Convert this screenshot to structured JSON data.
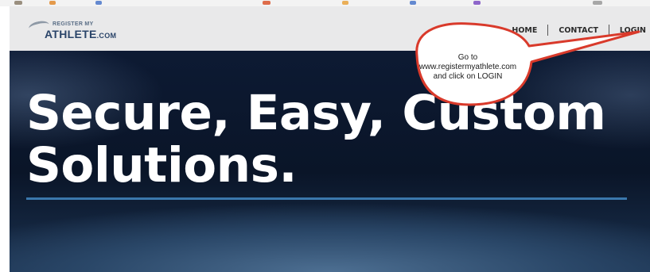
{
  "header": {
    "logo": {
      "top_text": "REGISTER MY",
      "main_text": "ATHLETE",
      "suffix": ".COM"
    },
    "nav": [
      {
        "label": "HOME"
      },
      {
        "label": "CONTACT"
      },
      {
        "label": "LOGIN"
      }
    ]
  },
  "hero": {
    "line1": "Secure, Easy, Custom",
    "line2": "Solutions."
  },
  "annotation": {
    "line1": "Go to",
    "line2": "www.registermyathlete.com",
    "line3": "and click on LOGIN",
    "outline_color": "#d93a2b",
    "fill_color": "#ffffff"
  },
  "colors": {
    "header_bg": "#e9e9ea",
    "hero_bg": "#0a1528",
    "accent_rule": "#3b78ad",
    "logo_blue": "#2a4469"
  }
}
